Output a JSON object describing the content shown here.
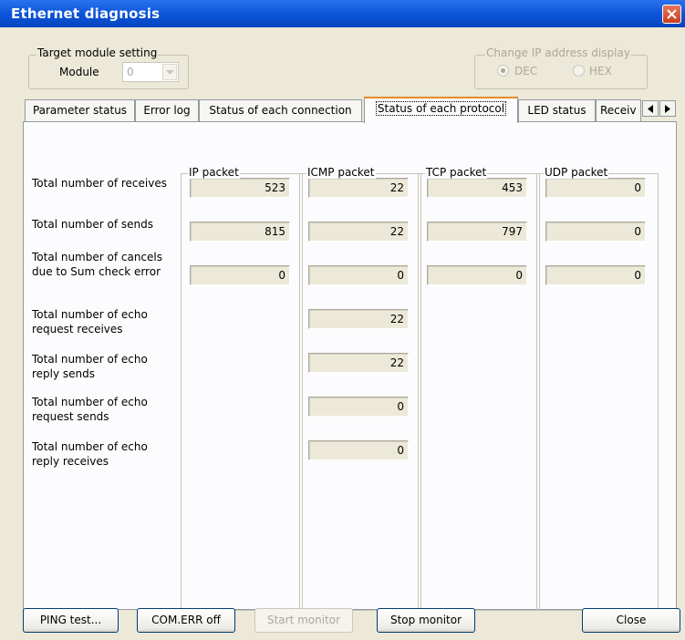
{
  "window": {
    "title": "Ethernet diagnosis"
  },
  "target_module": {
    "group_label": "Target module setting",
    "module_label": "Module",
    "module_value": "0"
  },
  "ip_display": {
    "group_label": "Change IP address display",
    "dec_label": "DEC",
    "hex_label": "HEX",
    "selected": "DEC"
  },
  "tabs": [
    {
      "label": "Parameter status"
    },
    {
      "label": "Error log"
    },
    {
      "label": "Status of each connection"
    },
    {
      "label": "Status of each protocol"
    },
    {
      "label": "LED status"
    },
    {
      "label": "Receiv"
    }
  ],
  "active_tab": "Status of each protocol",
  "columns": [
    "IP packet",
    "ICMP packet",
    "TCP packet",
    "UDP packet"
  ],
  "rows": [
    {
      "label": "Total number of receives",
      "values": [
        "523",
        "22",
        "453",
        "0"
      ]
    },
    {
      "label": "Total number of sends",
      "values": [
        "815",
        "22",
        "797",
        "0"
      ]
    },
    {
      "label": "Total number of cancels due to Sum check error",
      "values": [
        "0",
        "0",
        "0",
        "0"
      ]
    },
    {
      "label": "Total number of echo request receives",
      "values": [
        "",
        "22",
        "",
        ""
      ]
    },
    {
      "label": "Total number of echo reply sends",
      "values": [
        "",
        "22",
        "",
        ""
      ]
    },
    {
      "label": "Total number of echo request sends",
      "values": [
        "",
        "0",
        "",
        ""
      ]
    },
    {
      "label": "Total number of echo reply receives",
      "values": [
        "",
        "0",
        "",
        ""
      ]
    }
  ],
  "buttons": {
    "ping": "PING test...",
    "comerr": "COM.ERR off",
    "start": "Start monitor",
    "stop": "Stop monitor",
    "close": "Close"
  },
  "colors": {
    "titlebar": "#0a53d6",
    "active_tab_accent": "#e68b2c",
    "face": "#ece9d8"
  }
}
